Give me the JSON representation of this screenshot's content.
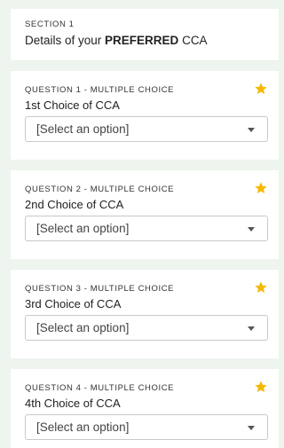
{
  "section": {
    "overline": "SECTION 1",
    "title_prefix": "Details of your ",
    "title_emphasis": "PREFERRED",
    "title_suffix": " CCA"
  },
  "questions": [
    {
      "overline": "QUESTION 1 - MULTIPLE CHOICE",
      "label": "1st Choice of CCA",
      "selected": "[Select an option]",
      "icon": "star-icon"
    },
    {
      "overline": "QUESTION 2 - MULTIPLE CHOICE",
      "label": "2nd Choice of CCA",
      "selected": "[Select an option]",
      "icon": "star-icon"
    },
    {
      "overline": "QUESTION 3 - MULTIPLE CHOICE",
      "label": "3rd Choice of CCA",
      "selected": "[Select an option]",
      "icon": "star-icon"
    },
    {
      "overline": "QUESTION 4 - MULTIPLE CHOICE",
      "label": "4th Choice of CCA",
      "selected": "[Select an option]",
      "icon": "star-icon"
    }
  ],
  "colors": {
    "page_background": "#eef4ee",
    "card_background": "#ffffff",
    "star": "#f5b800",
    "border": "#c9c9c9"
  }
}
